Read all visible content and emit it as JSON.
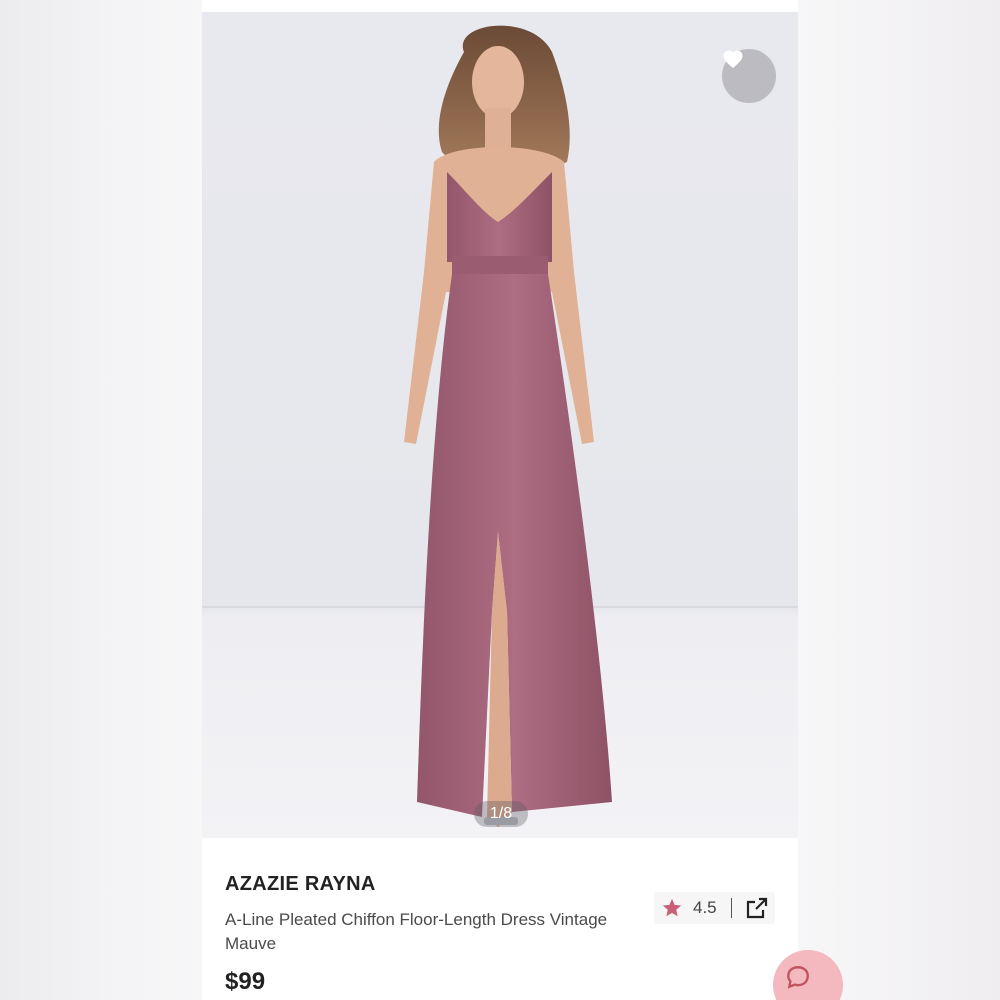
{
  "product": {
    "brand": "AZAZIE RAYNA",
    "description": "A-Line Pleated Chiffon Floor-Length Dress Vintage Mauve",
    "price": "$99",
    "rating": "4.5"
  },
  "gallery": {
    "counter": "1/8",
    "image_subject": "model wearing mauve floor-length chiffon dress with front slit"
  },
  "icons": {
    "favorite": "heart-icon",
    "rating": "star-icon",
    "share": "share-icon",
    "chat": "chat-icon"
  },
  "colors": {
    "dress": "#a8687c",
    "star": "#c9607a",
    "chat_button": "#f4b9bf",
    "background": "#e8e9ee"
  }
}
